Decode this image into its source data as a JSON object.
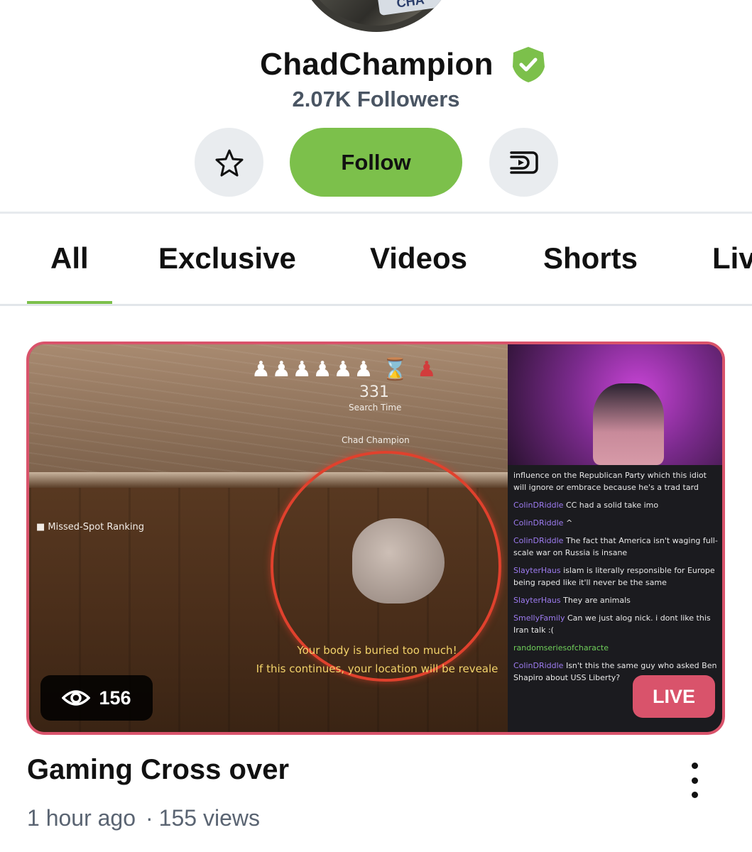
{
  "channel": {
    "avatar_text": "CHA",
    "name": "ChadChampion",
    "followers": "2.07K Followers",
    "accent_color": "#7cc04b"
  },
  "actions": {
    "star_icon": "star-icon",
    "follow_label": "Follow",
    "share_icon": "rumble-share-icon"
  },
  "tabs": [
    {
      "label": "All",
      "active": true
    },
    {
      "label": "Exclusive",
      "active": false
    },
    {
      "label": "Videos",
      "active": false
    },
    {
      "label": "Shorts",
      "active": false
    },
    {
      "label": "Liv",
      "active": false
    }
  ],
  "video": {
    "title": "Gaming Cross over",
    "time_ago": "1 hour ago",
    "views_text": "155 views",
    "live_viewers": "156",
    "live_label": "LIVE",
    "live_color": "#d9536b",
    "thumbnail": {
      "hud_count": "331",
      "hud_search": "Search Time",
      "hud_player": "Chad Champion",
      "missed_spot": "Missed-Spot Ranking",
      "warning_line1": "Your body is buried too much!",
      "warning_line2": "If this continues, your location will be reveale",
      "chat": [
        {
          "user": "",
          "text": "influence on the Republican Party which this idiot will ignore or embrace because he's a trad tard"
        },
        {
          "user": "ColinDRiddle",
          "text": "CC had a solid take imo"
        },
        {
          "user": "ColinDRiddle",
          "text": "^"
        },
        {
          "user": "ColinDRiddle",
          "text": "The fact that America isn't waging full-scale war on Russia is insane"
        },
        {
          "user": "SlayterHaus",
          "text": "islam is literally responsible for Europe being raped like it'll never be the same"
        },
        {
          "user": "SlayterHaus",
          "text": "They are animals"
        },
        {
          "user": "SmellyFamily",
          "text": "Can we just alog nick. i dont like this Iran talk :("
        },
        {
          "user": "randomseriesofcharacte",
          "text": ""
        },
        {
          "user": "ColinDRiddle",
          "text": "Isn't this the same guy who asked Ben Shapiro about USS Liberty?"
        }
      ]
    }
  }
}
